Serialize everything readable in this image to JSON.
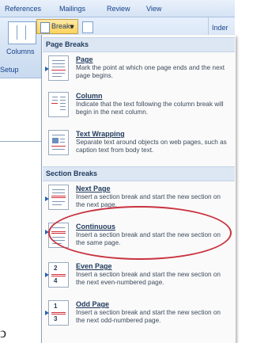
{
  "ribbon": {
    "tabs": [
      "References",
      "Mailings",
      "Review",
      "View"
    ],
    "breaks_label": "Breaks",
    "columns_label": "Columns",
    "setup_label": "Setup",
    "indent_label": "Inder"
  },
  "menu": {
    "page_breaks_header": "Page Breaks",
    "section_breaks_header": "Section Breaks",
    "items": [
      {
        "title": "Page",
        "desc": "Mark the point at which one page ends and the next page begins."
      },
      {
        "title": "Column",
        "desc": "Indicate that the text following the column break will begin in the next column."
      },
      {
        "title": "Text Wrapping",
        "desc": "Separate text around objects on web pages, such as caption text from body text."
      },
      {
        "title": "Next Page",
        "desc": "Insert a section break and start the new section on the next page."
      },
      {
        "title": "Continuous",
        "desc": "Insert a section break and start the new section on the same page."
      },
      {
        "title": "Even Page",
        "desc": "Insert a section break and start the new section on the next even-numbered page."
      },
      {
        "title": "Odd Page",
        "desc": "Insert a section break and start the new section on the next odd-numbered page."
      }
    ],
    "even_icon_numbers": [
      "2",
      "4"
    ],
    "odd_icon_numbers": [
      "1",
      "3"
    ]
  },
  "colors": {
    "highlight_circle": "#c9323e",
    "breaks_button": "#ffd35c"
  }
}
